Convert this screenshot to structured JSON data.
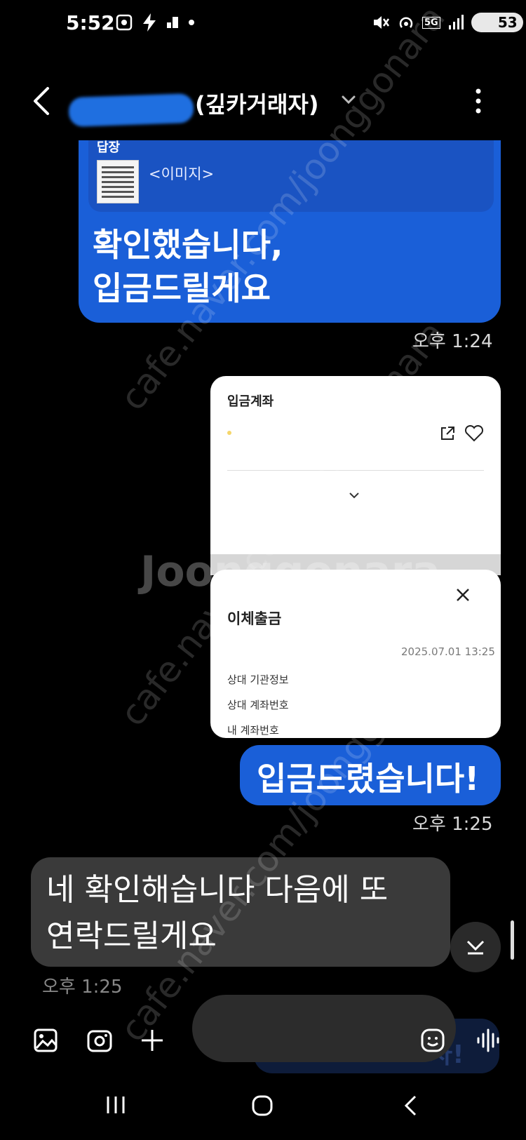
{
  "status_bar": {
    "time": "5:52",
    "battery": "53",
    "network": "5G"
  },
  "header": {
    "contact_name": "(깊카거래자)"
  },
  "messages": [
    {
      "direction": "sent",
      "reply_name": "답장",
      "reply_preview": "<이미지>",
      "text_line1": "확인했습니다,",
      "text_line2": "입금드릴게요",
      "time": "오후 1:24"
    },
    {
      "direction": "sent",
      "image1": {
        "title": "입금계좌"
      },
      "image2": {
        "title": "이체출금",
        "date": "2025.07.01 13:25",
        "rows": [
          "상대 기관정보",
          "상대 계좌번호",
          "내 계좌번호"
        ]
      }
    },
    {
      "direction": "sent",
      "text": "입금드렸습니다!",
      "time": "오후 1:25"
    },
    {
      "direction": "received",
      "text_line1": "네 확인해습니다 다음에 또",
      "text_line2": "연락드릴게요",
      "time": "오후 1:25"
    }
  ],
  "watermark": {
    "text": "cafe.naver.com/joonggonara",
    "logo": "Joonggonara"
  },
  "input_bar": {
    "ghost_text": "자!"
  },
  "colors": {
    "sent_bubble": "#1a5fd8",
    "received_bubble": "#3a3a3a",
    "background": "#000000"
  },
  "icons": [
    "back-icon",
    "chevron-down-icon",
    "more-vert-icon",
    "gallery-icon",
    "camera-icon",
    "plus-icon",
    "emoji-icon",
    "voice-icon",
    "share-icon",
    "heart-icon",
    "close-icon",
    "scroll-down-icon",
    "recent-apps-icon",
    "home-icon",
    "nav-back-icon"
  ]
}
